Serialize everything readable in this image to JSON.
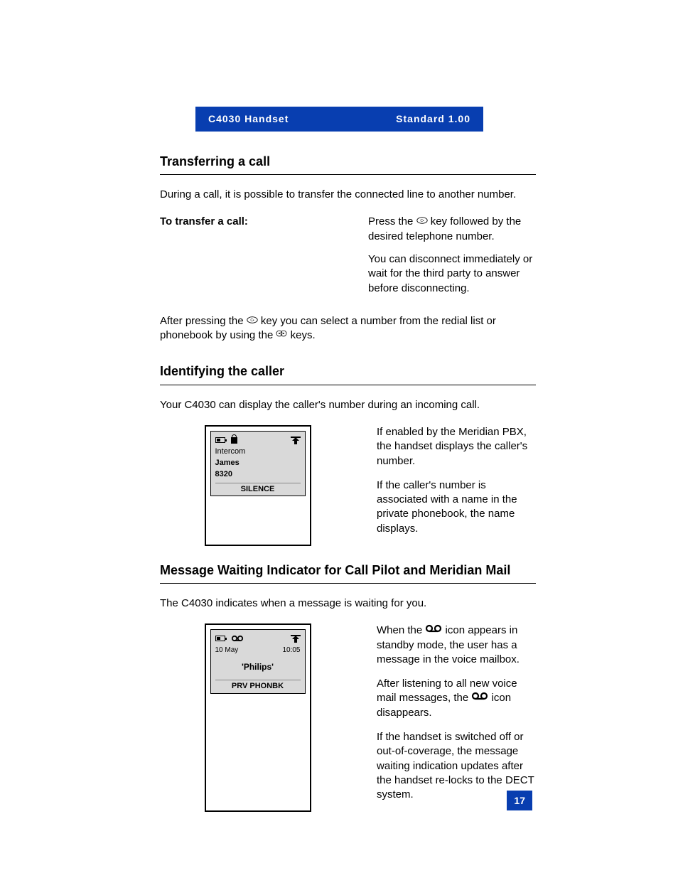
{
  "header": {
    "left": "C4030 Handset",
    "right": "Standard 1.00"
  },
  "page_number": "17",
  "sections": {
    "transfer": {
      "title": "Transferring a call",
      "intro": "During a call, it is possible to transfer the connected line to another number.",
      "label": "To transfer a call:",
      "step_before": "Press the ",
      "step_after": " key followed by the desired telephone number.",
      "step2": "You can disconnect immediately or wait for the third party to answer before disconnecting.",
      "note_before": "After pressing the ",
      "note_mid": " key you can select a number from the redial list or phonebook by using the ",
      "note_after": " keys."
    },
    "caller_id": {
      "title": "Identifying the caller",
      "intro": "Your C4030 can display the caller's number during an incoming call.",
      "p1": "If enabled by the Meridian PBX, the handset displays the caller's number.",
      "p2": "If the caller's number is associated with a name in the private phonebook, the name displays.",
      "lcd": {
        "line1": "Intercom",
        "line2": "James",
        "line3": "8320",
        "softkey": "SILENCE"
      }
    },
    "mwi": {
      "title": "Message Waiting Indicator for Call Pilot and Meridian Mail",
      "intro": "The C4030 indicates when a message is waiting for you.",
      "p1_before": "When the ",
      "p1_after": " icon appears in standby mode, the user has a message in the voice mailbox.",
      "p2_before": "After listening to all new voice mail messages, the ",
      "p2_after": " icon disappears.",
      "p3": "If the handset is switched off or out-of-coverage, the message waiting indication updates after the handset re-locks to the DECT system.",
      "lcd": {
        "date": "10 May",
        "time": "10:05",
        "name": "'Philips'",
        "softkey": "PRV PHONBK"
      }
    }
  }
}
